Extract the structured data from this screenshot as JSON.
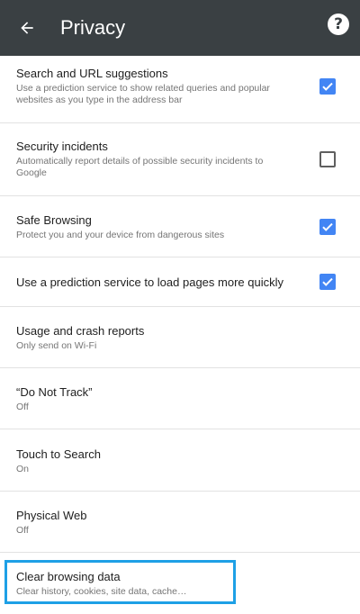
{
  "appbar": {
    "title": "Privacy",
    "back_icon": "arrow-left-icon",
    "help_icon": "help-circle-icon",
    "help_glyph": "?",
    "background_color": "#3a4043"
  },
  "settings": [
    {
      "title": "Search and URL suggestions",
      "summary": "Use a prediction service to show related queries and popular websites as you type in the address bar",
      "checked": true
    },
    {
      "title": "Security incidents",
      "summary": "Automatically report details of possible security incidents to Google",
      "checked": false
    },
    {
      "title": "Safe Browsing",
      "summary": "Protect you and your device from dangerous sites",
      "checked": true
    },
    {
      "title": "Use a prediction service to load pages more quickly",
      "checked": true
    },
    {
      "title": "Usage and crash reports",
      "summary": "Only send on Wi-Fi"
    },
    {
      "title": "“Do Not Track”",
      "summary": "Off"
    },
    {
      "title": "Touch to Search",
      "summary": "On"
    },
    {
      "title": "Physical Web",
      "summary": "Off"
    },
    {
      "title": "Clear browsing data",
      "summary": "Clear history, cookies, site data, cache…",
      "highlighted": true
    }
  ],
  "colors": {
    "checkbox_on": "#4285f4",
    "highlight_border": "#1ea0e6",
    "divider": "#e2e2e2"
  }
}
